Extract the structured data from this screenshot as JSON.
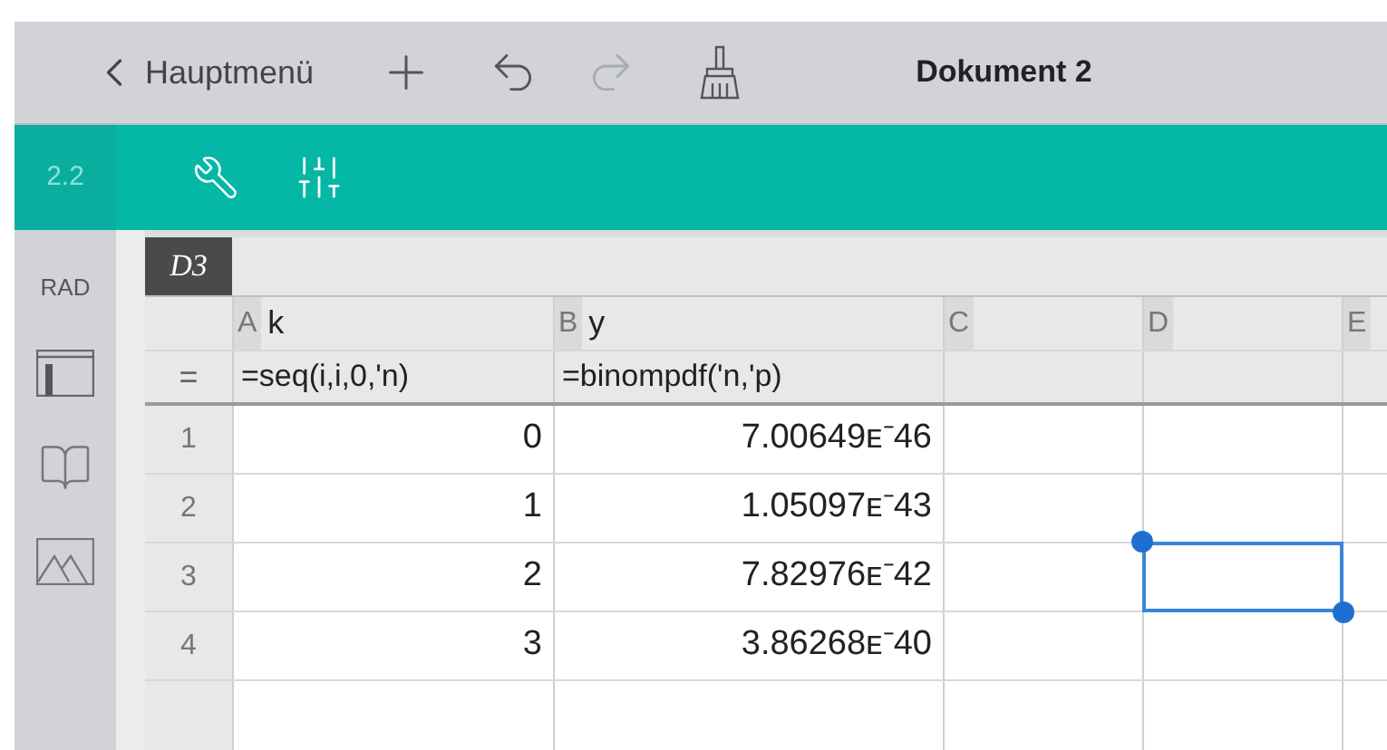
{
  "toolbar": {
    "back_label": "Hauptmenü",
    "redo_disabled": true,
    "title": "Dokument 2"
  },
  "page_bar": {
    "page_number": "2.2"
  },
  "sidebar": {
    "mode": "RAD"
  },
  "spreadsheet": {
    "cell_reference": "D3",
    "columns": [
      {
        "letter": "A",
        "name": "k"
      },
      {
        "letter": "B",
        "name": "y"
      },
      {
        "letter": "C"
      },
      {
        "letter": "D"
      },
      {
        "letter": "E"
      }
    ],
    "formula_marker": "=",
    "formulas": [
      "=seq(i,i,0,'n)",
      "=binompdf('n,'p)"
    ],
    "rows": [
      {
        "number": "1",
        "k": "0",
        "y": "7.00649ᴇ⁻46",
        "d_selected": false
      },
      {
        "number": "2",
        "k": "1",
        "y": "1.05097ᴇ⁻43",
        "d_selected": false
      },
      {
        "number": "3",
        "k": "2",
        "y": "7.82976ᴇ⁻42",
        "d_selected": true
      },
      {
        "number": "4",
        "k": "3",
        "y": "3.86268ᴇ⁻40",
        "d_selected": false
      }
    ]
  }
}
